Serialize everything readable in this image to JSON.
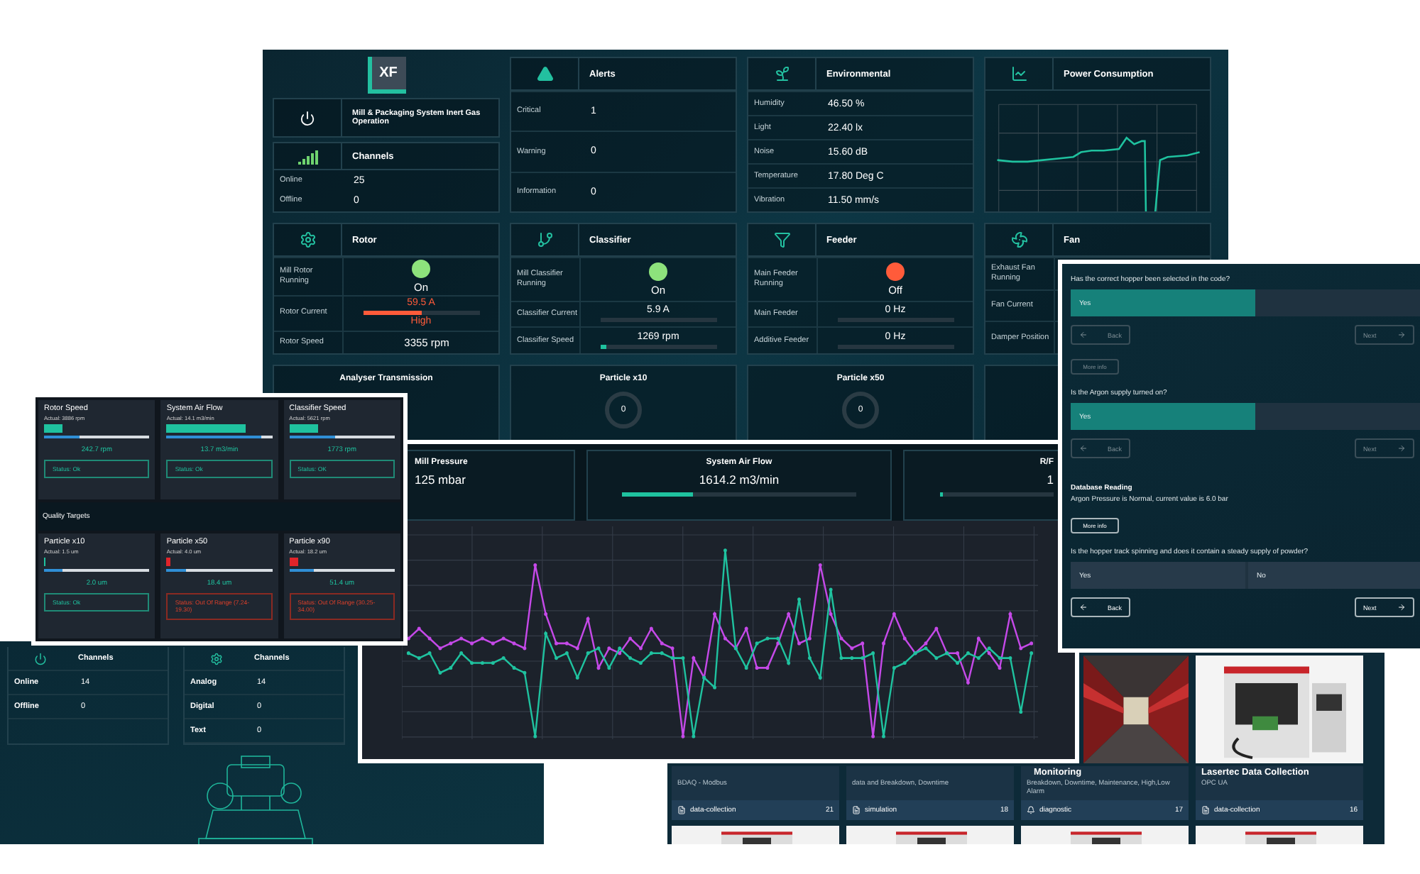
{
  "dashboard": {
    "logo": "XF",
    "system": "Mill & Packaging System Inert Gas Operation",
    "channels": {
      "title": "Channels",
      "rows": [
        {
          "label": "Online",
          "value": "25"
        },
        {
          "label": "Offline",
          "value": "0"
        }
      ]
    },
    "alerts": {
      "title": "Alerts",
      "rows": [
        {
          "label": "Critical",
          "value": "1"
        },
        {
          "label": "Warning",
          "value": "0"
        },
        {
          "label": "Information",
          "value": "0"
        }
      ]
    },
    "environmental": {
      "title": "Environmental",
      "rows": [
        {
          "label": "Humidity",
          "value": "46.50 %"
        },
        {
          "label": "Light",
          "value": "22.40 lx"
        },
        {
          "label": "Noise",
          "value": "15.60 dB"
        },
        {
          "label": "Temperature",
          "value": "17.80 Deg C"
        },
        {
          "label": "Vibration",
          "value": "11.50 mm/s"
        }
      ]
    },
    "power": {
      "title": "Power Consumption"
    },
    "machines": [
      {
        "title": "Rotor",
        "rows": [
          {
            "kind": "indicator",
            "label": "Mill Rotor Running",
            "on": true,
            "value": "On"
          },
          {
            "kind": "bar",
            "label": "Rotor Current",
            "value": "59.5 A",
            "level": 0.5,
            "alarm": true,
            "note": "High"
          },
          {
            "kind": "text",
            "label": "Rotor Speed",
            "value": "3355 rpm"
          }
        ]
      },
      {
        "title": "Classifier",
        "rows": [
          {
            "kind": "indicator",
            "label": "Mill Classifier Running",
            "on": true,
            "value": "On"
          },
          {
            "kind": "bar",
            "label": "Classifier Current",
            "value": "5.9 A",
            "level": 0,
            "alarm": false
          },
          {
            "kind": "bar",
            "label": "Classifier Speed",
            "value": "1269 rpm",
            "level": 0.05,
            "alarm": false
          }
        ]
      },
      {
        "title": "Feeder",
        "rows": [
          {
            "kind": "indicator",
            "label": "Main Feeder Running",
            "on": false,
            "value": "Off"
          },
          {
            "kind": "bar",
            "label": "Main Feeder",
            "value": "0 Hz",
            "level": 0,
            "alarm": false
          },
          {
            "kind": "bar",
            "label": "Additive Feeder",
            "value": "0 Hz",
            "level": 0,
            "alarm": false
          }
        ]
      },
      {
        "title": "Fan",
        "rows": [
          {
            "kind": "text",
            "label": "Exhaust Fan Running"
          },
          {
            "kind": "text",
            "label": "Fan Current"
          },
          {
            "kind": "text",
            "label": "Damper Position"
          }
        ]
      }
    ],
    "gauges": [
      {
        "kind": "header",
        "title": "Analyser Transmission"
      },
      {
        "kind": "gauge",
        "title": "Particle x10",
        "value": "0"
      },
      {
        "kind": "gauge",
        "title": "Particle x50",
        "value": "0"
      }
    ]
  },
  "channels_panel": {
    "tables": [
      {
        "title": "Channels",
        "rows": [
          {
            "label": "Online",
            "value": "14"
          },
          {
            "label": "Offline",
            "value": "0"
          }
        ]
      },
      {
        "title": "Channels",
        "rows": [
          {
            "label": "Analog",
            "value": "14"
          },
          {
            "label": "Digital",
            "value": "0"
          },
          {
            "label": "Text",
            "value": "0"
          }
        ]
      }
    ]
  },
  "catalog": {
    "cards": [
      {
        "kind": "plain",
        "subtitle": "BDAQ - Modbus",
        "tag": "data-collection",
        "count": "21"
      },
      {
        "kind": "plain",
        "subtitle": "data and Breakdown, Downtime",
        "tag": "simulation",
        "count": "18"
      },
      {
        "kind": "picture",
        "title": "Monitoring",
        "subtitle": "Breakdown, Downtime, Maintenance, High,Low Alarm",
        "tag": "diagnostic",
        "count": "17"
      },
      {
        "kind": "picture",
        "title": "Lasertec Data Collection",
        "subtitle": "OPC UA",
        "tag": "data-collection",
        "count": "16"
      }
    ]
  },
  "trend": {
    "tiles": [
      {
        "title": "Mill Pressure",
        "value": "125 mbar"
      },
      {
        "title": "System Air Flow",
        "value": "1614.2 m3/min",
        "level": 0.3
      },
      {
        "title": "R/F",
        "value": "1",
        "level": 0.02
      }
    ]
  },
  "targets": {
    "process": [
      {
        "title": "Rotor Speed",
        "actual": "Actual: 3886 rpm",
        "level": 0.18,
        "value": "242.7 rpm",
        "status": "Status: Ok",
        "alarm": false
      },
      {
        "title": "System Air Flow",
        "actual": "Actual: 14.1 m3/min",
        "level": 0.75,
        "value": "13.7 m3/min",
        "status": "Status: Ok",
        "alarm": false
      },
      {
        "title": "Classifier Speed",
        "actual": "Actual: 5621 rpm",
        "level": 0.28,
        "value": "1773 rpm",
        "status": "Status: OK",
        "alarm": false
      }
    ],
    "heading": "Quality Targets",
    "quality": [
      {
        "title": "Particle x10",
        "actual": "Actual: 1.5 um",
        "level": 0.02,
        "value": "2.0 um",
        "status": "Status: Ok",
        "alarm": false
      },
      {
        "title": "Particle x50",
        "actual": "Actual: 4.0 um",
        "level": 0.04,
        "value": "18.4 um",
        "status": "Status: Out Of Range (7.24-19.30)",
        "alarm": true
      },
      {
        "title": "Particle x90",
        "actual": "Actual: 18.2 um",
        "level": 0.08,
        "value": "51.4 um",
        "status": "Status: Out Of Range (30.25-34.00)",
        "alarm": true
      }
    ]
  },
  "checklist": {
    "items": [
      {
        "kind": "question",
        "text": "Has the correct hopper been selected in the code?",
        "options": [
          {
            "label": "Yes",
            "selected": true
          }
        ],
        "nav": [
          {
            "label": "Back",
            "disabled": true
          },
          {
            "label": "Next",
            "disabled": true
          }
        ]
      },
      {
        "kind": "button",
        "label": "More info",
        "disabled": true
      },
      {
        "kind": "question",
        "text": "Is the Argon supply turned on?",
        "options": [
          {
            "label": "Yes",
            "selected": true
          }
        ],
        "nav": [
          {
            "label": "Back",
            "disabled": true
          },
          {
            "label": "Next",
            "disabled": true
          }
        ]
      },
      {
        "kind": "reading",
        "title": "Database Reading",
        "text": "Argon Pressure is Normal, current value is 6.0 bar"
      },
      {
        "kind": "button",
        "label": "More info",
        "disabled": false
      },
      {
        "kind": "question",
        "text": "Is the hopper track spinning and does it contain a steady supply of powder?",
        "options": [
          {
            "label": "Yes",
            "selected": false
          },
          {
            "label": "No",
            "selected": false
          }
        ],
        "nav": [
          {
            "label": "Back",
            "disabled": false
          },
          {
            "label": "Next",
            "disabled": false
          }
        ]
      }
    ]
  }
}
